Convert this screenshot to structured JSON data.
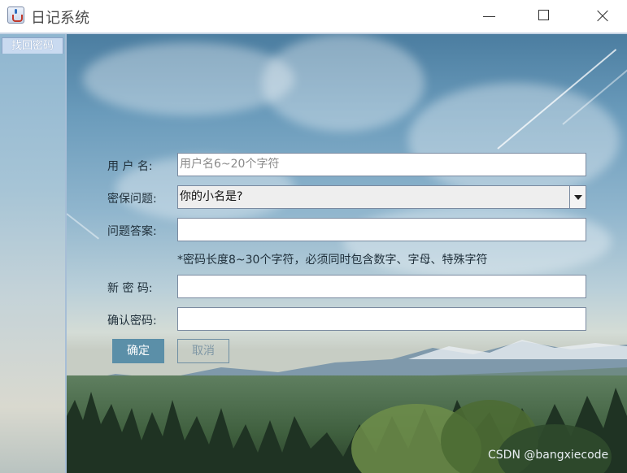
{
  "window": {
    "title": "日记系统"
  },
  "tab": {
    "label": "找回密码"
  },
  "form": {
    "username_label": "用 户 名:",
    "username_placeholder": "用户名6~20个字符",
    "question_label": "密保问题:",
    "question_selected": "你的小名是?",
    "answer_label": "问题答案:",
    "answer_value": "",
    "password_hint": "*密码长度8~30个字符，必须同时包含数字、字母、特殊字符",
    "new_password_label": "新 密 码:",
    "new_password_value": "",
    "confirm_password_label": "确认密码:",
    "confirm_password_value": "",
    "ok_label": "确定",
    "cancel_label": "取消"
  },
  "watermark": "CSDN @bangxiecode",
  "icons": [
    "java-app-icon",
    "minimize-icon",
    "maximize-icon",
    "close-icon",
    "dropdown-arrow-icon"
  ],
  "colors": {
    "accent": "#5b8fa8",
    "titlebar": "#ffffff",
    "tab": "#c9daf0"
  }
}
